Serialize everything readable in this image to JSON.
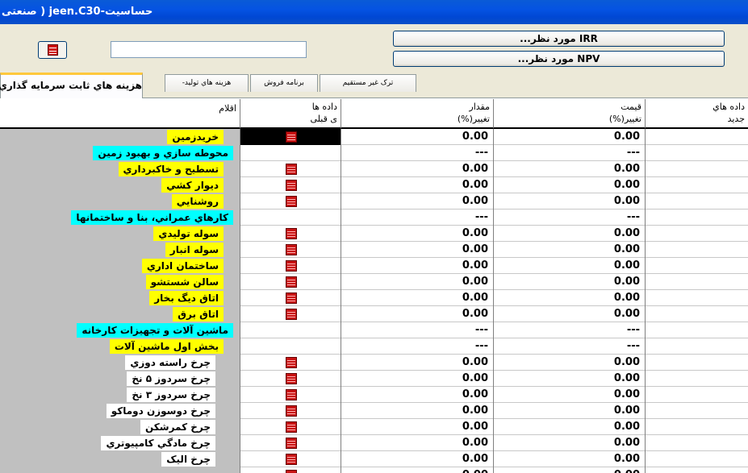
{
  "window": {
    "title": "حساسیت-jeen.C30 ( صنعتی"
  },
  "toolbar": {
    "irr_label": "IRR مورد نظر...",
    "npv_label": "NPV مورد نظر..."
  },
  "tabs": [
    {
      "label": "هزینه هاي ثابت سرمايه گذاري",
      "active": true
    },
    {
      "label": "هزینه هاي توليد-"
    },
    {
      "label": "برنامه فروش"
    },
    {
      "label": "ترک غیر مستقیم"
    }
  ],
  "columns": {
    "items": "اقلام",
    "prev_data_l1": "داده ها",
    "prev_data_l2": "ی قبلی",
    "qty_l1": "مقدار",
    "qty_l2": "تغییر(%)",
    "price_l1": "قیمت",
    "price_l2": "تغییر(%)",
    "new_l1": "داده هاي",
    "new_l2": "جدید"
  },
  "rows": [
    {
      "label": "خريدزمين",
      "color": "yellow",
      "qty": "0.00",
      "price": "0.00",
      "icon": true,
      "selected": true
    },
    {
      "label": "محوطه سازي و بهبود زمين",
      "color": "cyan",
      "qty": "---",
      "price": "---",
      "icon": false
    },
    {
      "label": "تسطيح و خاكبرداري",
      "color": "yellow",
      "qty": "0.00",
      "price": "0.00",
      "icon": true
    },
    {
      "label": "ديوار كشي",
      "color": "yellow",
      "qty": "0.00",
      "price": "0.00",
      "icon": true
    },
    {
      "label": "روشنايي",
      "color": "yellow",
      "qty": "0.00",
      "price": "0.00",
      "icon": true
    },
    {
      "label": "كارهاي عمراني، بنا و ساختمانها",
      "color": "cyan",
      "qty": "---",
      "price": "---",
      "icon": false
    },
    {
      "label": "سوله توليدي",
      "color": "yellow",
      "qty": "0.00",
      "price": "0.00",
      "icon": true
    },
    {
      "label": "سوله انبار",
      "color": "yellow",
      "qty": "0.00",
      "price": "0.00",
      "icon": true
    },
    {
      "label": "ساختمان اداري",
      "color": "yellow",
      "qty": "0.00",
      "price": "0.00",
      "icon": true
    },
    {
      "label": "سالن شستشو",
      "color": "yellow",
      "qty": "0.00",
      "price": "0.00",
      "icon": true
    },
    {
      "label": "اتاق ديگ بخار",
      "color": "yellow",
      "qty": "0.00",
      "price": "0.00",
      "icon": true
    },
    {
      "label": "اتاق برق",
      "color": "yellow",
      "qty": "0.00",
      "price": "0.00",
      "icon": true
    },
    {
      "label": "ماشين آلات و تجهيزات كارخانه",
      "color": "cyan",
      "qty": "---",
      "price": "---",
      "icon": false
    },
    {
      "label": "بخش اول ماشين آلات",
      "color": "yellow",
      "qty": "---",
      "price": "---",
      "icon": false
    },
    {
      "label": "چرخ راسته دوزي",
      "color": "white",
      "qty": "0.00",
      "price": "0.00",
      "icon": true
    },
    {
      "label": "چرخ سردوز ۵ نخ",
      "color": "white",
      "qty": "0.00",
      "price": "0.00",
      "icon": true
    },
    {
      "label": "چرخ سردوز ۳ نخ",
      "color": "white",
      "qty": "0.00",
      "price": "0.00",
      "icon": true
    },
    {
      "label": "چرخ دوسوزن دوماكو",
      "color": "white",
      "qty": "0.00",
      "price": "0.00",
      "icon": true
    },
    {
      "label": "چرخ كمرشكن",
      "color": "white",
      "qty": "0.00",
      "price": "0.00",
      "icon": true
    },
    {
      "label": "چرخ مادگي كامپيوتري",
      "color": "white",
      "qty": "0.00",
      "price": "0.00",
      "icon": true
    },
    {
      "label": "چرخ اليک",
      "color": "white",
      "qty": "0.00",
      "price": "0.00",
      "icon": true
    },
    {
      "label": "",
      "color": "white",
      "qty": "0.00",
      "price": "0.00",
      "icon": true
    }
  ]
}
